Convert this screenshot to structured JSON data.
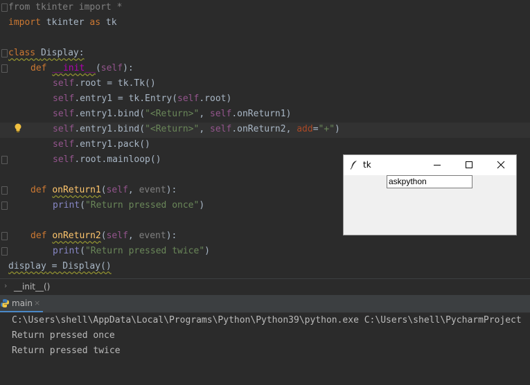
{
  "editor": {
    "code": {
      "l1": {
        "a": "from ",
        "b": "tkinter ",
        "c": "import ",
        "d": "*"
      },
      "l2": {
        "a": "import ",
        "b": "tkinter ",
        "c": "as ",
        "d": "tk"
      },
      "l4": {
        "a": "class ",
        "b": "Display:"
      },
      "l5": {
        "a": "def ",
        "b": "__init__",
        "c": "(",
        "d": "self",
        "e": "):"
      },
      "l6": {
        "a": "self",
        "b": ".root = tk.Tk()"
      },
      "l7": {
        "a": "self",
        "b": ".entry1 = tk.Entry(",
        "c": "self",
        "d": ".root)"
      },
      "l8": {
        "a": "self",
        "b": ".entry1.bind(",
        "c": "\"<Return>\"",
        "d": ", ",
        "e": "self",
        "f": ".onReturn1)"
      },
      "l9": {
        "a": "self",
        "b": ".entry1.bind(",
        "c": "\"<Return>\"",
        "d": ", ",
        "e": "self",
        "f": ".onReturn2, ",
        "g": "add",
        "h": "=",
        "i": "\"+\"",
        "j": ")"
      },
      "l10": {
        "a": "self",
        "b": ".entry1.pack()"
      },
      "l11": {
        "a": "self",
        "b": ".root.mainloop()"
      },
      "l13": {
        "a": "def ",
        "b": "onReturn1",
        "c": "(",
        "d": "self",
        "e": ", ",
        "f": "event",
        "g": "):"
      },
      "l14": {
        "a": "print",
        "b": "(",
        "c": "\"Return pressed once\"",
        "d": ")"
      },
      "l16": {
        "a": "def ",
        "b": "onReturn2",
        "c": "(",
        "d": "self",
        "e": ", ",
        "f": "event",
        "g": "):"
      },
      "l17": {
        "a": "print",
        "b": "(",
        "c": "\"Return pressed twice\"",
        "d": ")"
      },
      "l18": {
        "a": "display",
        "b": " = Display()"
      }
    }
  },
  "breadcrumb": {
    "chevron": "›",
    "item": "__init__()"
  },
  "run_panel": {
    "tab_label": "main",
    "close_glyph": "×"
  },
  "console": {
    "lines": [
      "C:\\Users\\shell\\AppData\\Local\\Programs\\Python\\Python39\\python.exe C:\\Users\\shell\\PycharmProject",
      "Return pressed once",
      "Return pressed twice"
    ]
  },
  "tk_window": {
    "title": "tk",
    "entry_value": "askpython",
    "icon": "feather-icon",
    "buttons": [
      "minimize-icon",
      "maximize-icon",
      "close-icon"
    ]
  },
  "colors": {
    "editor_bg": "#2b2b2b",
    "keyword": "#cc7832",
    "self": "#94558d",
    "function": "#ffc66d",
    "string": "#6a8759",
    "accent": "#4a88c7"
  }
}
